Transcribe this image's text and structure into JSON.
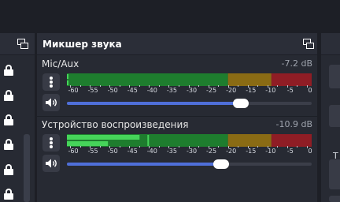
{
  "mixer": {
    "title": "Микшер звука",
    "channels": [
      {
        "name": "Mic/Aux",
        "db": "-7.2 dB",
        "volume_percent": 71,
        "level_peak_dbfs": -60,
        "level_rms_dbfs": -60
      },
      {
        "name": "Устройство воспроизведения",
        "db": "-10.9 dB",
        "volume_percent": 63,
        "level_peak_dbfs": -42,
        "level_rms_dbfs": -50
      }
    ],
    "scale_labels": [
      "-60",
      "-55",
      "-50",
      "-45",
      "-40",
      "-35",
      "-30",
      "-25",
      "-20",
      "-15",
      "-10",
      "-5",
      "0"
    ]
  },
  "right_dock": {
    "fragment_label": "T"
  },
  "colors": {
    "background": "#1d1f26",
    "panel": "#272a33",
    "meter_green": "#1e7d2e",
    "meter_green_active": "#46d45a",
    "meter_yellow": "#8a6b14",
    "meter_red": "#8f1d25",
    "fader_fill": "#4f6fd9"
  },
  "icons": {
    "lock": "lock-icon",
    "menu": "vertical-dots-icon",
    "speaker": "speaker-icon",
    "dock": "undock-icon"
  }
}
